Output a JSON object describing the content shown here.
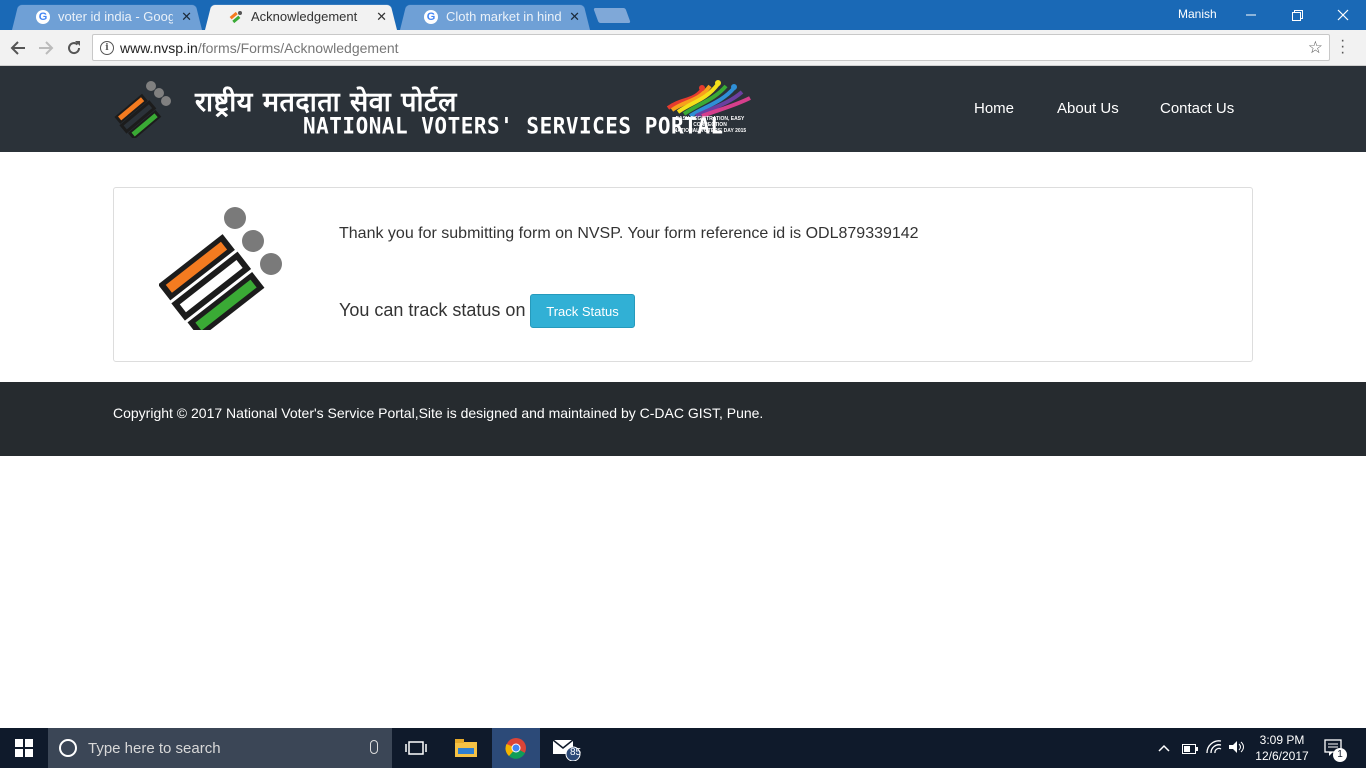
{
  "browser": {
    "tabs": [
      {
        "title": "voter id india - Google S",
        "favicon": "google-g-icon",
        "active": false
      },
      {
        "title": "Acknowledgement",
        "favicon": "nvsp-icon",
        "active": true
      },
      {
        "title": "Cloth market in hindi - G",
        "favicon": "google-g-icon",
        "active": false
      }
    ],
    "user": "Manish",
    "url_host": "www.nvsp.in",
    "url_path": "/forms/Forms/Acknowledgement",
    "close_glyph": "✕"
  },
  "site": {
    "title_hindi": "राष्ट्रीय मतदाता सेवा पोर्टल",
    "title_english": "NATIONAL VOTERS' SERVICES PORTAL",
    "badge_lines": [
      "EASY REGISTRATION, EASY CORRECTION",
      "NATIONAL VOTERS' DAY 2015"
    ],
    "nav": [
      "Home",
      "About Us",
      "Contact Us"
    ]
  },
  "ack": {
    "message": "Thank you for submitting form on NVSP. Your form reference id is ODL879339142",
    "track_text": "You can track status on",
    "track_button": "Track Status"
  },
  "footer": {
    "text": "Copyright © 2017 National Voter's Service Portal,Site is designed and maintained by C-DAC GIST, Pune."
  },
  "taskbar": {
    "search_placeholder": "Type here to search",
    "mail_badge": "85",
    "time": "3:09 PM",
    "date": "12/6/2017",
    "notification_count": "1"
  },
  "colors": {
    "chrome_blue": "#1a69b6",
    "header_dark": "#2b3239",
    "footer_dark": "#262b2f",
    "button_info": "#31b0d5",
    "saffron": "#f47b20",
    "green": "#3aaa35"
  }
}
